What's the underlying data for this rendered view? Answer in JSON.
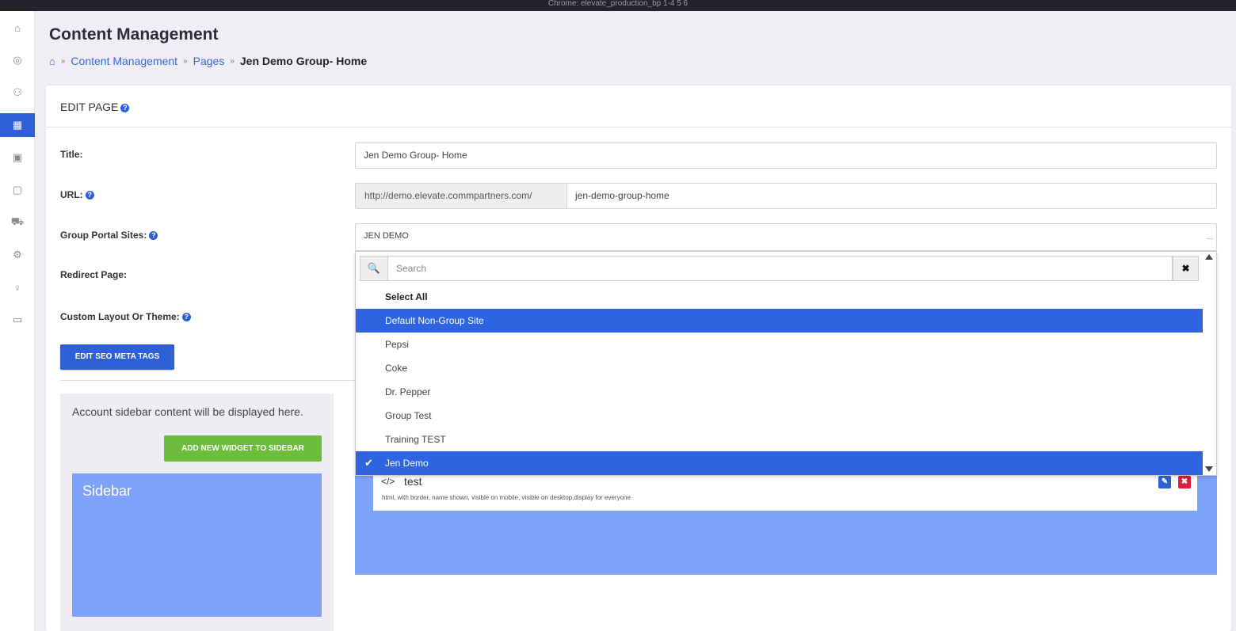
{
  "window": {
    "title": "Chrome: elevate_production_bp 1-4 5 6"
  },
  "nav": {
    "items": [
      {
        "icon": "home-icon",
        "glyph": "⌂"
      },
      {
        "icon": "layers-icon",
        "glyph": "◎"
      },
      {
        "icon": "users-icon",
        "glyph": "⚇"
      },
      {
        "icon": "book-icon",
        "glyph": "▦",
        "active": true
      },
      {
        "icon": "grid-icon",
        "glyph": "▣"
      },
      {
        "icon": "clipboard-icon",
        "glyph": "▢"
      },
      {
        "icon": "cart-icon",
        "glyph": "⛟"
      },
      {
        "icon": "gear-icon",
        "glyph": "⚙"
      },
      {
        "icon": "lightbulb-icon",
        "glyph": "♀"
      },
      {
        "icon": "monitor-icon",
        "glyph": "▭"
      }
    ]
  },
  "header": {
    "title": "Content Management",
    "breadcrumb": {
      "home_glyph": "⌂",
      "sep": "»",
      "items": [
        "Content Management",
        "Pages"
      ],
      "current": "Jen Demo Group- Home"
    }
  },
  "card": {
    "title": "EDIT PAGE",
    "help": "?"
  },
  "form": {
    "title_label": "Title:",
    "title_value": "Jen Demo Group- Home",
    "url_label": "URL:",
    "url_prefix": "http://demo.elevate.commpartners.com/",
    "url_value": "jen-demo-group-home",
    "portal_label": "Group Portal Sites:",
    "portal_value": "JEN DEMO",
    "portal_more": "...",
    "redirect_label": "Redirect Page:",
    "layout_label": "Custom Layout Or Theme:",
    "seo_button": "EDIT SEO META TAGS"
  },
  "sidebar": {
    "notice": "Account sidebar content will be displayed here.",
    "add_widget_button": "ADD NEW WIDGET TO SIDEBAR",
    "title": "Sidebar"
  },
  "widget": {
    "code_glyph": "</>",
    "name": "test",
    "description": "html, with border, name shown, visible on mobile, visible on desktop,display for everyone",
    "edit_glyph": "✎",
    "delete_glyph": "✖"
  },
  "dropdown": {
    "search_icon": "🔍",
    "search_placeholder": "Search",
    "clear_glyph": "✖",
    "select_all": "Select All",
    "options": [
      {
        "label": "Default Non-Group Site",
        "highlighted": true,
        "checked": false
      },
      {
        "label": "Pepsi",
        "highlighted": false,
        "checked": false
      },
      {
        "label": "Coke",
        "highlighted": false,
        "checked": false
      },
      {
        "label": "Dr. Pepper",
        "highlighted": false,
        "checked": false
      },
      {
        "label": "Group Test",
        "highlighted": false,
        "checked": false
      },
      {
        "label": "Training TEST",
        "highlighted": false,
        "checked": false
      },
      {
        "label": "Jen Demo",
        "highlighted": true,
        "checked": true
      }
    ]
  },
  "colors": {
    "primary": "#2f5fd6",
    "success": "#6cbd3c",
    "danger": "#e01e3c",
    "widget_area": "#7ea2fb"
  }
}
